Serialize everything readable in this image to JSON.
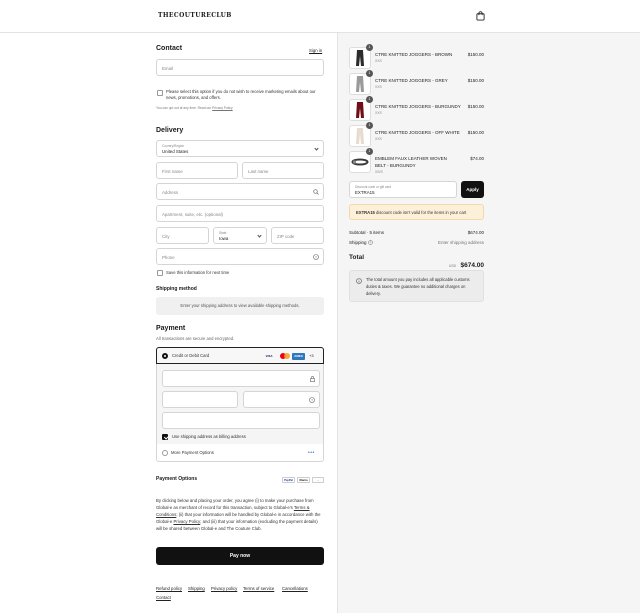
{
  "header": {
    "logo": "THECOUTURECLUB",
    "bag_icon": "shopping-bag-icon"
  },
  "contact": {
    "title": "Contact",
    "sign_in": "Sign in",
    "email_placeholder": "Email",
    "marketing_opt_text": "Please select this option if you do not wish to receive marketing emails about our news, promotions, and offers.",
    "opt_out_note": "You can opt out at any time. Read our",
    "privacy_link": "Privacy Policy"
  },
  "delivery": {
    "title": "Delivery",
    "country_label": "Country/Region",
    "country_value": "United States",
    "first_name": "First name",
    "last_name": "Last name",
    "address": "Address",
    "apartment": "Apartment, suite, etc. (optional)",
    "city": "City",
    "state_label": "State",
    "state_value": "Iowa",
    "zip": "ZIP code",
    "phone": "Phone",
    "save_info": "Save this information for next time"
  },
  "shipping_method": {
    "title": "Shipping method",
    "message": "Enter your shipping address to view available shipping methods."
  },
  "payment": {
    "title": "Payment",
    "subtitle": "All transactions are secure and encrypted.",
    "card_option": "Credit or Debit Card",
    "card_brands": [
      "VISA",
      "MC",
      "AMEX"
    ],
    "more_count": "+3",
    "billing_same": "Use shipping address as billing address",
    "more_options": "More Payment Options",
    "options_title": "Payment Options",
    "option_brands": [
      "PayPal",
      "Klarna",
      "..."
    ]
  },
  "legal": {
    "p1": "By clicking below and placing your order, you agree (i) to make your purchase from Global-e as merchant of record for this transaction, subject to Global-e's",
    "terms_link": "Terms & Conditions",
    "p2": "; (ii) that your information will be handled by Global-e in accordance with the Global-e",
    "privacy_link": "Privacy Policy",
    "p3": "; and (iii) that your information (excluding the payment details) will be shared between Global-e and The Couture Club."
  },
  "pay_button": "Pay now",
  "footer_links": [
    "Refund policy",
    "Shipping",
    "Privacy policy",
    "Terms of service",
    "Cancellations",
    "Contact"
  ],
  "cart": {
    "items": [
      {
        "name": "CTRE KNITTED JOGGERS - BROWN",
        "size": "XXS",
        "price": "$150.00",
        "qty": "1",
        "color": "#2b2b2b"
      },
      {
        "name": "CTRE KNITTED JOGGERS - GREY",
        "size": "XXS",
        "price": "$150.00",
        "qty": "1",
        "color": "#9a9a9a"
      },
      {
        "name": "CTRE KNITTED JOGGERS - BURGUNDY",
        "size": "XXS",
        "price": "$150.00",
        "qty": "1",
        "color": "#6e0f18"
      },
      {
        "name": "CTRE KNITTED JOGGERS - OFF WHITE",
        "size": "XXS",
        "price": "$150.00",
        "qty": "1",
        "color": "#e8dcd0"
      },
      {
        "name": "EMBLEM FAUX LEATHER WOVEN BELT - BURGUNDY",
        "size": "XS/S",
        "price": "$74.00",
        "qty": "1",
        "color": "#3a3a3a"
      }
    ],
    "discount_label": "Discount code or gift card",
    "discount_value": "EXTRA15",
    "apply": "Apply",
    "error_code": "EXTRA15",
    "error_text": "discount code isn't valid for the items in your cart",
    "subtotal_label": "Subtotal · 5 items",
    "subtotal_value": "$674.00",
    "shipping_label": "Shipping",
    "shipping_value": "Enter shipping address",
    "total_label": "Total",
    "currency": "USD",
    "total_value": "$674.00",
    "duties_note": "The total amount you pay includes all applicable customs duties & taxes. We guarantee no additional charges on delivery."
  }
}
